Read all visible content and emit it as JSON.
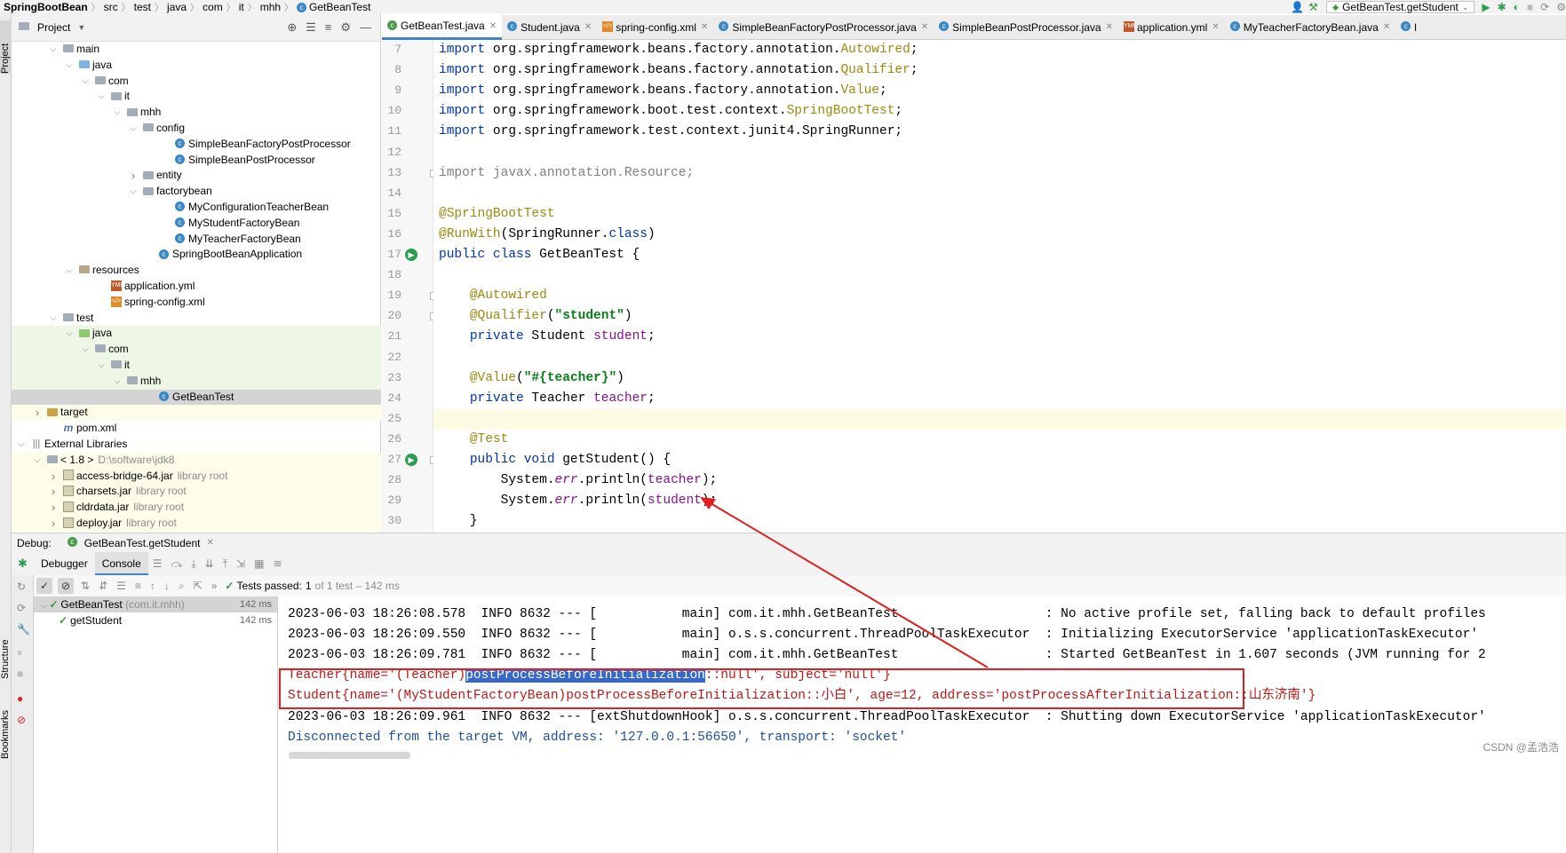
{
  "nav": {
    "crumbs": [
      "SpringBootBean",
      "src",
      "test",
      "java",
      "com",
      "it",
      "mhh",
      "GetBeanTest"
    ],
    "run_config": "GetBeanTest.getStudent"
  },
  "sidebar": {
    "project_tab": "Project",
    "structure_tab": "Structure",
    "bookmarks_tab": "Bookmarks"
  },
  "project": {
    "title": "Project",
    "tree": [
      {
        "label": "main",
        "level": 2,
        "icon": "folder-src",
        "arrow": "down",
        "bg": "none"
      },
      {
        "label": "java",
        "level": 3,
        "icon": "folder-src-blue",
        "arrow": "down",
        "bg": "none"
      },
      {
        "label": "com",
        "level": 4,
        "icon": "folder-pkg",
        "arrow": "down",
        "bg": "none"
      },
      {
        "label": "it",
        "level": 5,
        "icon": "folder-pkg",
        "arrow": "down",
        "bg": "none"
      },
      {
        "label": "mhh",
        "level": 6,
        "icon": "folder-pkg",
        "arrow": "down",
        "bg": "none"
      },
      {
        "label": "config",
        "level": 7,
        "icon": "folder-pkg",
        "arrow": "down",
        "bg": "none"
      },
      {
        "label": "SimpleBeanFactoryPostProcessor",
        "level": 9,
        "icon": "class",
        "arrow": "",
        "bg": "none"
      },
      {
        "label": "SimpleBeanPostProcessor",
        "level": 9,
        "icon": "class",
        "arrow": "",
        "bg": "none"
      },
      {
        "label": "entity",
        "level": 7,
        "icon": "folder-pkg",
        "arrow": "right",
        "bg": "none"
      },
      {
        "label": "factorybean",
        "level": 7,
        "icon": "folder-pkg",
        "arrow": "down",
        "bg": "none"
      },
      {
        "label": "MyConfigurationTeacherBean",
        "level": 9,
        "icon": "class",
        "arrow": "",
        "bg": "none"
      },
      {
        "label": "MyStudentFactoryBean",
        "level": 9,
        "icon": "class",
        "arrow": "",
        "bg": "none"
      },
      {
        "label": "MyTeacherFactoryBean",
        "level": 9,
        "icon": "class",
        "arrow": "",
        "bg": "none"
      },
      {
        "label": "SpringBootBeanApplication",
        "level": 8,
        "icon": "class-run",
        "arrow": "",
        "bg": "none"
      },
      {
        "label": "resources",
        "level": 3,
        "icon": "folder-res",
        "arrow": "down",
        "bg": "none"
      },
      {
        "label": "application.yml",
        "level": 5,
        "icon": "yml",
        "arrow": "",
        "bg": "none"
      },
      {
        "label": "spring-config.xml",
        "level": 5,
        "icon": "xml",
        "arrow": "",
        "bg": "none"
      },
      {
        "label": "test",
        "level": 2,
        "icon": "folder-pkg",
        "arrow": "down",
        "bg": "none"
      },
      {
        "label": "java",
        "level": 3,
        "icon": "folder-test",
        "arrow": "down",
        "bg": "green"
      },
      {
        "label": "com",
        "level": 4,
        "icon": "folder-pkg",
        "arrow": "down",
        "bg": "green"
      },
      {
        "label": "it",
        "level": 5,
        "icon": "folder-pkg",
        "arrow": "down",
        "bg": "green"
      },
      {
        "label": "mhh",
        "level": 6,
        "icon": "folder-pkg",
        "arrow": "down",
        "bg": "green"
      },
      {
        "label": "GetBeanTest",
        "level": 8,
        "icon": "class-test",
        "arrow": "",
        "bg": "sel"
      },
      {
        "label": "target",
        "level": 1,
        "icon": "folder-target",
        "arrow": "right",
        "bg": "yellow"
      },
      {
        "label": "pom.xml",
        "level": 2,
        "icon": "m",
        "arrow": "",
        "bg": "none"
      },
      {
        "label": "External Libraries",
        "level": 0,
        "icon": "lib",
        "arrow": "down",
        "bg": "none"
      },
      {
        "label": "< 1.8 >",
        "suffix": "D:\\software\\jdk8",
        "level": 1,
        "icon": "folder-pkg",
        "arrow": "down",
        "bg": "yellow"
      },
      {
        "label": "access-bridge-64.jar",
        "suffix": "library root",
        "level": 2,
        "icon": "jar",
        "arrow": "right",
        "bg": "yellow"
      },
      {
        "label": "charsets.jar",
        "suffix": "library root",
        "level": 2,
        "icon": "jar",
        "arrow": "right",
        "bg": "yellow"
      },
      {
        "label": "cldrdata.jar",
        "suffix": "library root",
        "level": 2,
        "icon": "jar",
        "arrow": "right",
        "bg": "yellow"
      },
      {
        "label": "deploy.jar",
        "suffix": "library root",
        "level": 2,
        "icon": "jar",
        "arrow": "right",
        "bg": "yellow"
      }
    ]
  },
  "editor": {
    "tabs": [
      {
        "label": "GetBeanTest.java",
        "icon": "class-test",
        "active": true
      },
      {
        "label": "Student.java",
        "icon": "class",
        "active": false
      },
      {
        "label": "spring-config.xml",
        "icon": "xml",
        "active": false
      },
      {
        "label": "SimpleBeanFactoryPostProcessor.java",
        "icon": "class",
        "active": false
      },
      {
        "label": "SimpleBeanPostProcessor.java",
        "icon": "class",
        "active": false
      },
      {
        "label": "application.yml",
        "icon": "yml",
        "active": false
      },
      {
        "label": "MyTeacherFactoryBean.java",
        "icon": "class",
        "active": false
      },
      {
        "label": "l",
        "icon": "class",
        "active": false
      }
    ],
    "lines": [
      {
        "n": "7",
        "html": "<span class='kw'>import</span> org.springframework.beans.factory.annotation.<span class='ann'>Autowired</span>;"
      },
      {
        "n": "8",
        "html": "<span class='kw'>import</span> org.springframework.beans.factory.annotation.<span class='ann'>Qualifier</span>;"
      },
      {
        "n": "9",
        "html": "<span class='kw'>import</span> org.springframework.beans.factory.annotation.<span class='ann'>Value</span>;"
      },
      {
        "n": "10",
        "html": "<span class='kw'>import</span> org.springframework.boot.test.context.<span class='ann'>SpringBootTest</span>;"
      },
      {
        "n": "11",
        "html": "<span class='kw'>import</span> org.springframework.test.context.junit4.SpringRunner;"
      },
      {
        "n": "12",
        "html": ""
      },
      {
        "n": "13",
        "html": "<span class='gray'>import javax.annotation.Resource;</span>"
      },
      {
        "n": "14",
        "html": ""
      },
      {
        "n": "15",
        "html": "<span class='ann'>@SpringBootTest</span>"
      },
      {
        "n": "16",
        "html": "<span class='ann'>@RunWith</span>(SpringRunner.<span class='kw'>class</span>)"
      },
      {
        "n": "17",
        "html": "<span class='kw'>public class</span> GetBeanTest {"
      },
      {
        "n": "18",
        "html": ""
      },
      {
        "n": "19",
        "html": "    <span class='ann'>@Autowired</span>"
      },
      {
        "n": "20",
        "html": "    <span class='ann'>@Qualifier</span>(<span class='str'>\"student\"</span>)"
      },
      {
        "n": "21",
        "html": "    <span class='kw'>private</span> Student <span class='fld'>student</span>;"
      },
      {
        "n": "22",
        "html": ""
      },
      {
        "n": "23",
        "html": "    <span class='ann'>@Value</span>(<span class='str'>\"#{teacher}\"</span>)"
      },
      {
        "n": "24",
        "html": "    <span class='kw'>private</span> Teacher <span class='fld'>teacher</span>;"
      },
      {
        "n": "25",
        "html": ""
      },
      {
        "n": "26",
        "html": "    <span class='ann'>@Test</span>"
      },
      {
        "n": "27",
        "html": "    <span class='kw'>public void</span> getStudent() {"
      },
      {
        "n": "28",
        "html": "        System.<span class='ital'>err</span>.println(<span class='fld'>teacher</span>);"
      },
      {
        "n": "29",
        "html": "        System.<span class='ital'>err</span>.println(<span class='fld'>student</span>);"
      },
      {
        "n": "30",
        "html": "    }"
      }
    ]
  },
  "debug": {
    "label": "Debug:",
    "session_tab": "GetBeanTest.getStudent",
    "tabs": [
      "Debugger",
      "Console"
    ],
    "tests_passed_label": "Tests passed:",
    "tests_passed_count": "1",
    "tests_passed_detail": "of 1 test – 142 ms",
    "test_tree": [
      {
        "label": "GetBeanTest",
        "suffix": "(com.it.mhh)",
        "ms": "142 ms",
        "level": 0
      },
      {
        "label": "getStudent",
        "suffix": "",
        "ms": "142 ms",
        "level": 1
      }
    ]
  },
  "console": {
    "lines": [
      {
        "kind": "plain",
        "text": "2023-06-03 18:26:08.578  INFO 8632 --- [           main] com.it.mhh.GetBeanTest                   : No active profile set, falling back to default profiles"
      },
      {
        "kind": "plain",
        "text": "2023-06-03 18:26:09.550  INFO 8632 --- [           main] o.s.s.concurrent.ThreadPoolTaskExecutor  : Initializing ExecutorService 'applicationTaskExecutor'"
      },
      {
        "kind": "plain",
        "text": "2023-06-03 18:26:09.781  INFO 8632 --- [           main] com.it.mhh.GetBeanTest                   : Started GetBeanTest in 1.607 seconds (JVM running for 2"
      },
      {
        "kind": "teacher",
        "pre": "Teacher{name='(Teacher)",
        "sel": "postProcessBeforeInitialization",
        "post": "::null', subject='null'}"
      },
      {
        "kind": "err",
        "text": "Student{name='(MyStudentFactoryBean)postProcessBeforeInitialization::小白', age=12, address='postProcessAfterInitialization::山东济南'}"
      },
      {
        "kind": "plain",
        "text": "2023-06-03 18:26:09.961  INFO 8632 --- [extShutdownHook] o.s.s.concurrent.ThreadPoolTaskExecutor  : Shutting down ExecutorService 'applicationTaskExecutor'"
      },
      {
        "kind": "blue",
        "text": "Disconnected from the target VM, address: '127.0.0.1:56650', transport: 'socket'"
      }
    ]
  },
  "watermark": "CSDN @孟浩浩",
  "colors": {
    "annotation_box": "#e02020",
    "accent": "#4083c9"
  }
}
